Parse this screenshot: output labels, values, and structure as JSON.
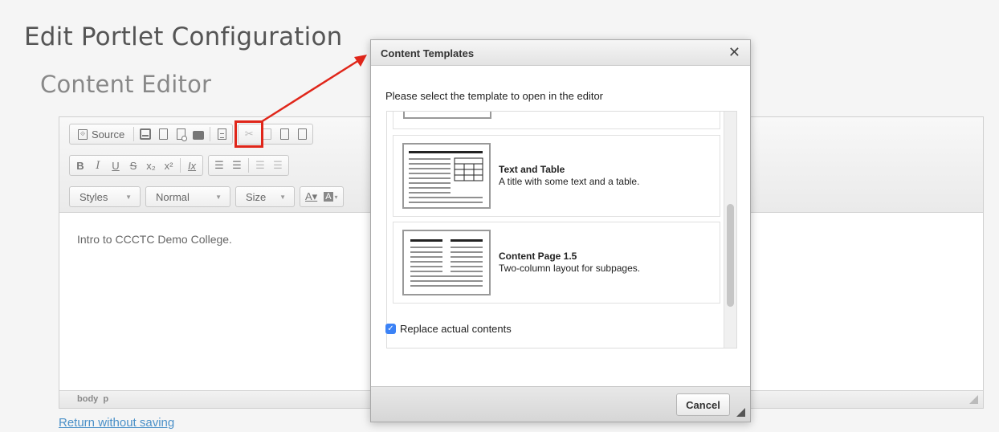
{
  "page": {
    "title": "Edit Portlet Configuration",
    "section_title": "Content Editor",
    "return_link": "Return without saving"
  },
  "toolbar": {
    "source_label": "Source",
    "styles_label": "Styles",
    "format_label": "Normal",
    "size_label": "Size",
    "row2": [
      "B",
      "I",
      "U",
      "S",
      "x₂",
      "x²",
      "Ix"
    ]
  },
  "editor": {
    "content": "Intro to CCCTC Demo College.",
    "statusbar_path": "body  p"
  },
  "dialog": {
    "title": "Content Templates",
    "close_glyph": "✕",
    "intro": "Please select the template to open in the editor",
    "templates": [
      {
        "name": "Text and Table",
        "description": "A title with some text and a table."
      },
      {
        "name": "Content Page 1.5",
        "description": "Two-column layout for subpages."
      }
    ],
    "checkbox_label": "Replace actual contents",
    "checkbox_checked": true,
    "cancel_label": "Cancel"
  },
  "colors": {
    "highlight": "#e0261a",
    "link": "#4a90c8",
    "checkbox": "#3b82f6"
  }
}
